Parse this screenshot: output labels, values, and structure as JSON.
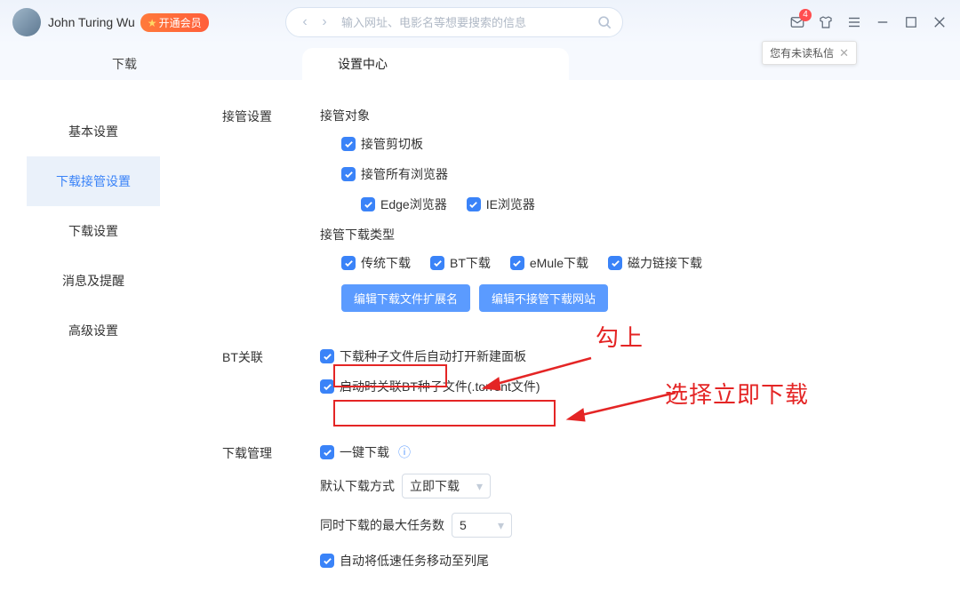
{
  "titlebar": {
    "username": "John Turing Wu",
    "vip_label": "开通会员",
    "search_placeholder": "输入网址、电影名等想要搜索的信息",
    "mail_badge": "4",
    "tooltip_text": "您有未读私信"
  },
  "tabs": {
    "download": "下载",
    "settings": "设置中心"
  },
  "sidebar": {
    "items": [
      "基本设置",
      "下载接管设置",
      "下载设置",
      "消息及提醒",
      "高级设置"
    ],
    "active_index": 1
  },
  "sections": {
    "takeover": {
      "label": "接管设置",
      "target_head": "接管对象",
      "clipboard": "接管剪切板",
      "browsers": "接管所有浏览器",
      "edge": "Edge浏览器",
      "ie": "IE浏览器",
      "type_head": "接管下载类型",
      "trad": "传统下载",
      "bt": "BT下载",
      "emule": "eMule下载",
      "magnet": "磁力链接下载",
      "btn_ext": "编辑下载文件扩展名",
      "btn_site": "编辑不接管下载网站"
    },
    "bt": {
      "label": "BT关联",
      "auto_open": "下载种子文件后自动打开新建面板",
      "assoc": "启动时关联BT种子文件(.torrent文件)"
    },
    "dlmgr": {
      "label": "下载管理",
      "one_click": "一键下载",
      "default_mode_label": "默认下载方式",
      "default_mode_value": "立即下载",
      "max_tasks_label": "同时下载的最大任务数",
      "max_tasks_value": "5",
      "move_slow": "自动将低速任务移动至列尾"
    }
  },
  "annotations": {
    "check": "勾上",
    "choose": "选择立即下载"
  }
}
